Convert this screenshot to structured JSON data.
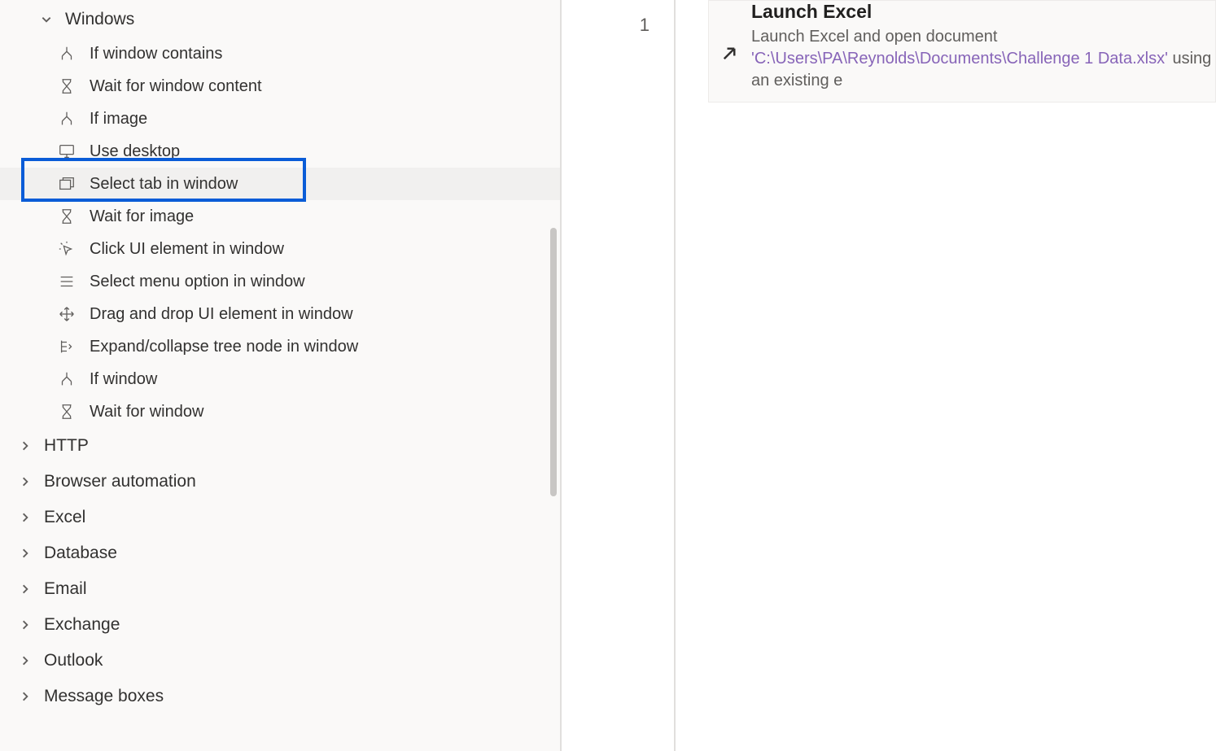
{
  "actionsPanel": {
    "expandedCategory": "Windows",
    "windowsActions": [
      {
        "label": "If window contains",
        "icon": "branch"
      },
      {
        "label": "Wait for window content",
        "icon": "hourglass"
      },
      {
        "label": "If image",
        "icon": "branch"
      },
      {
        "label": "Use desktop",
        "icon": "desktop"
      },
      {
        "label": "Select tab in window",
        "icon": "tabs",
        "highlighted": true
      },
      {
        "label": "Wait for image",
        "icon": "hourglass"
      },
      {
        "label": "Click UI element in window",
        "icon": "click"
      },
      {
        "label": "Select menu option in window",
        "icon": "menu"
      },
      {
        "label": "Drag and drop UI element in window",
        "icon": "drag"
      },
      {
        "label": "Expand/collapse tree node in window",
        "icon": "tree"
      },
      {
        "label": "If window",
        "icon": "branch"
      },
      {
        "label": "Wait for window",
        "icon": "hourglass"
      }
    ],
    "collapsedCategories": [
      "HTTP",
      "Browser automation",
      "Excel",
      "Database",
      "Email",
      "Exchange",
      "Outlook",
      "Message boxes"
    ]
  },
  "flow": {
    "lineNumber": "1",
    "step": {
      "title": "Launch Excel",
      "descPrefix": "Launch Excel and open document ",
      "path": "'C:\\Users\\PA\\Reynolds\\Documents\\Challenge 1 Data.xlsx'",
      "descSuffix": " using an existing e"
    }
  }
}
